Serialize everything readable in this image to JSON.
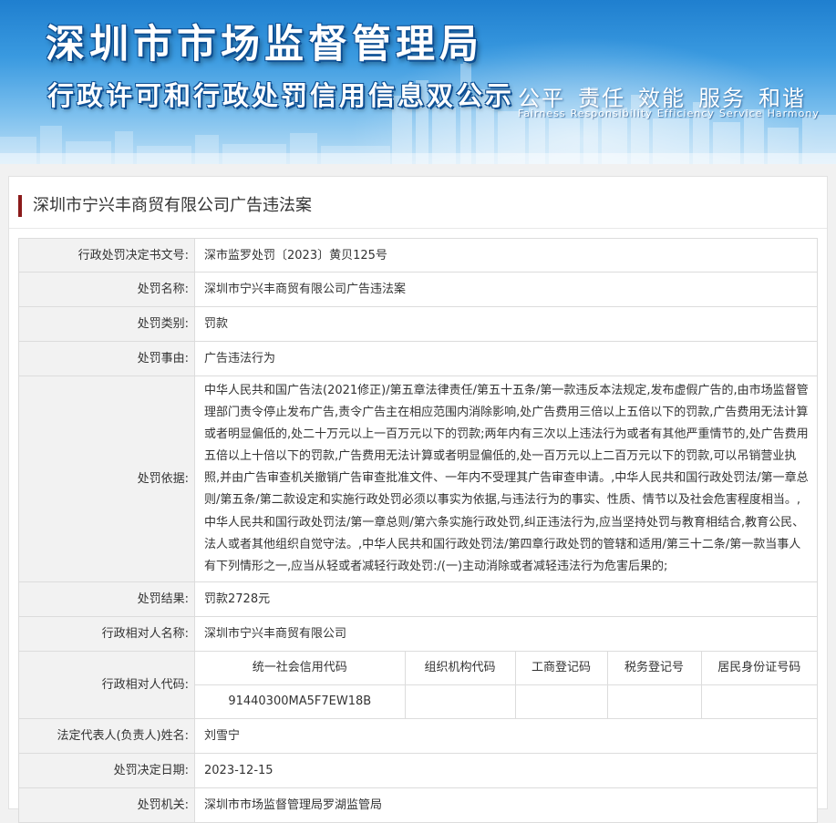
{
  "banner": {
    "title": "深圳市市场监督管理局",
    "subtitle": "行政许可和行政处罚信用信息双公示",
    "slogan_cn": [
      "公平",
      "责任",
      "效能",
      "服务",
      "和谐"
    ],
    "slogan_en": [
      "Fairness",
      "Responsibility",
      "Efficiency",
      "Service",
      "Harmony"
    ]
  },
  "case": {
    "title": "深圳市宁兴丰商贸有限公司广告违法案"
  },
  "fields": {
    "doc_no": {
      "label": "行政处罚决定书文号:",
      "value": "深市监罗处罚〔2023〕黄贝125号"
    },
    "name": {
      "label": "处罚名称:",
      "value": "深圳市宁兴丰商贸有限公司广告违法案"
    },
    "category": {
      "label": "处罚类别:",
      "value": "罚款"
    },
    "reason": {
      "label": "处罚事由:",
      "value": "广告违法行为"
    },
    "basis": {
      "label": "处罚依据:",
      "value": "中华人民共和国广告法(2021修正)/第五章法律责任/第五十五条/第一款违反本法规定,发布虚假广告的,由市场监督管理部门责令停止发布广告,责令广告主在相应范围内消除影响,处广告费用三倍以上五倍以下的罚款,广告费用无法计算或者明显偏低的,处二十万元以上一百万元以下的罚款;两年内有三次以上违法行为或者有其他严重情节的,处广告费用五倍以上十倍以下的罚款,广告费用无法计算或者明显偏低的,处一百万元以上二百万元以下的罚款,可以吊销营业执照,并由广告审查机关撤销广告审查批准文件、一年内不受理其广告审查申请。,中华人民共和国行政处罚法/第一章总则/第五条/第二款设定和实施行政处罚必须以事实为依据,与违法行为的事实、性质、情节以及社会危害程度相当。,中华人民共和国行政处罚法/第一章总则/第六条实施行政处罚,纠正违法行为,应当坚持处罚与教育相结合,教育公民、法人或者其他组织自觉守法。,中华人民共和国行政处罚法/第四章行政处罚的管辖和适用/第三十二条/第一款当事人有下列情形之一,应当从轻或者减轻行政处罚:/(一)主动消除或者减轻违法行为危害后果的;"
    },
    "result": {
      "label": "处罚结果:",
      "value": "罚款2728元"
    },
    "party_name": {
      "label": "行政相对人名称:",
      "value": "深圳市宁兴丰商贸有限公司"
    },
    "party_code": {
      "label": "行政相对人代码:",
      "headers": [
        "统一社会信用代码",
        "组织机构代码",
        "工商登记码",
        "税务登记号",
        "居民身份证号码"
      ],
      "values": [
        "91440300MA5F7EW18B",
        "",
        "",
        "",
        ""
      ]
    },
    "legal_rep": {
      "label": "法定代表人(负责人)姓名:",
      "value": "刘雪宁"
    },
    "decision_date": {
      "label": "处罚决定日期:",
      "value": "2023-12-15"
    },
    "authority": {
      "label": "处罚机关:",
      "value": "深圳市市场监督管理局罗湖监管局"
    }
  },
  "colors": {
    "banner_top": "#1f7fcf",
    "accent_bar": "#8b1a1a",
    "label_bg": "#f2f2f2",
    "border": "#dcdcdc"
  }
}
